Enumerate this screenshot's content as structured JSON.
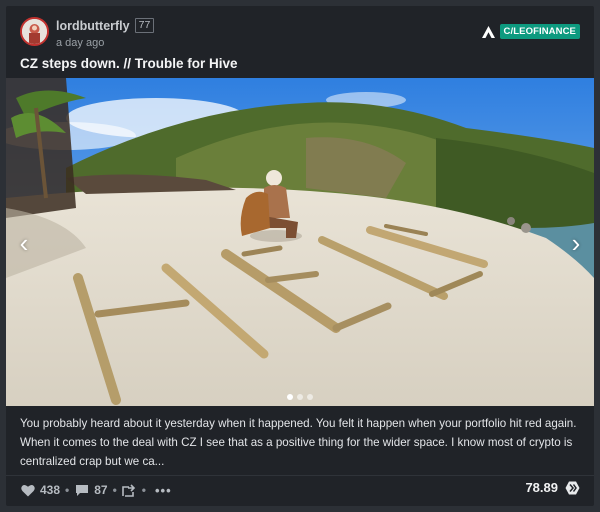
{
  "post": {
    "author": "lordbutterfly",
    "reputation": "77",
    "time": "a day ago",
    "community": "C/LEOFINANCE",
    "title": "CZ steps down. // Trouble for Hive",
    "excerpt": "You probably heard about it yesterday when it happened. You felt it happen when your portfolio hit red again. When it comes to the deal with CZ I see that as a positive thing for the wider space. I know most of crypto is centralized crap but we ca...",
    "image_description": "Man and dog sitting on a sandy beach beside driftwood logs spelling a word",
    "carousel": {
      "total": 3,
      "active": 0
    }
  },
  "footer": {
    "likes": "438",
    "comments": "87",
    "payout": "78.89"
  },
  "icons": {
    "heart": "heart-icon",
    "comment": "comment-icon",
    "reblog": "reblog-icon",
    "more": "more-icon",
    "hive": "hive-icon",
    "prev": "chevron-left-icon",
    "next": "chevron-right-icon"
  },
  "colors": {
    "accent": "#0d9a7f",
    "background": "#202328"
  }
}
